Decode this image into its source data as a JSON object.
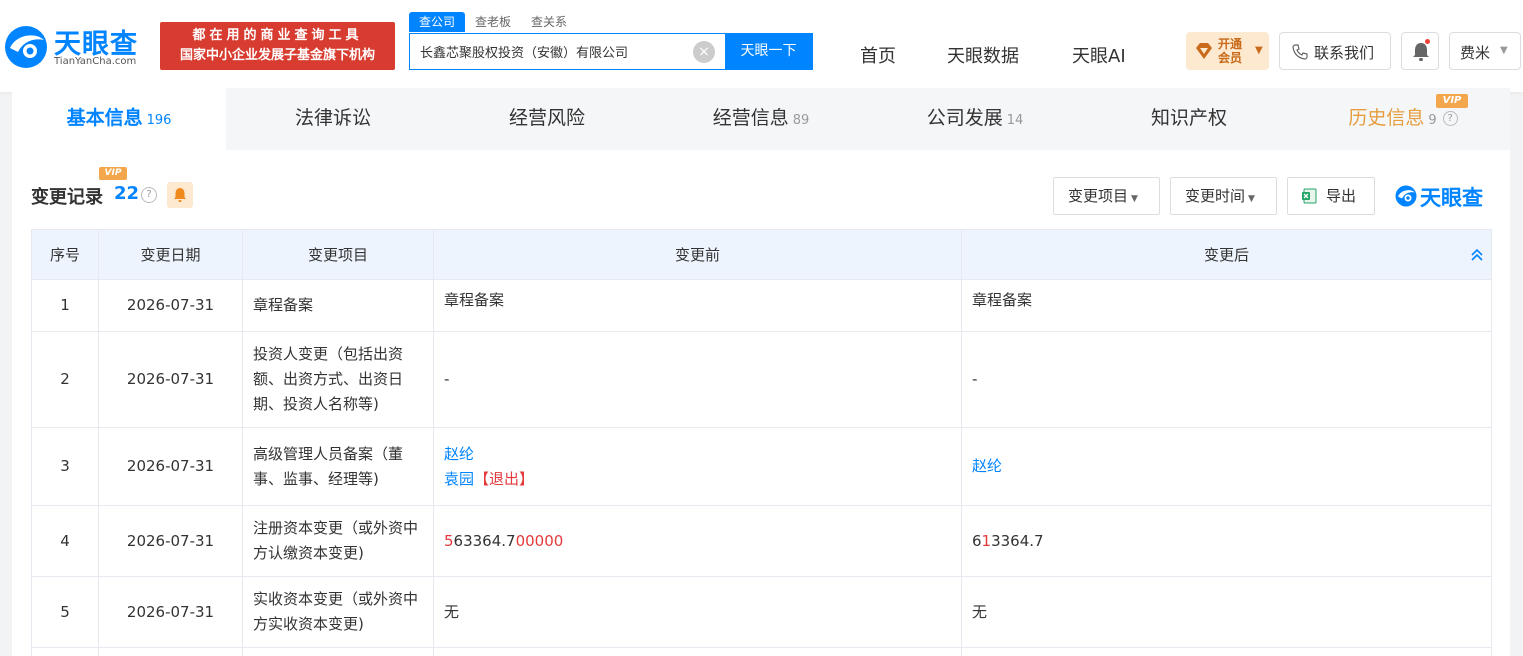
{
  "header": {
    "logo_text": "天眼查",
    "logo_domain": "TianYanCha.com",
    "slogan_line1": "都在用的商业查询工具",
    "slogan_line2": "国家中小企业发展子基金旗下机构",
    "search_tabs": [
      "查公司",
      "查老板",
      "查关系"
    ],
    "search_value": "长鑫芯聚股权投资（安徽）有限公司",
    "search_button": "天眼一下",
    "nav": [
      "首页",
      "天眼数据",
      "天眼AI"
    ],
    "vip_text": "开通会员",
    "contact": "联系我们",
    "user": "费米"
  },
  "tabs": {
    "basic": {
      "label": "基本信息",
      "count": "196"
    },
    "legal": {
      "label": "法律诉讼"
    },
    "risk": {
      "label": "经营风险"
    },
    "operation": {
      "label": "经营信息",
      "count": "89"
    },
    "development": {
      "label": "公司发展",
      "count": "14"
    },
    "ip": {
      "label": "知识产权"
    },
    "history": {
      "label": "历史信息",
      "count": "9",
      "vip": "VIP"
    }
  },
  "section": {
    "title": "变更记录",
    "count": "22",
    "vip": "VIP",
    "filter_item": "变更项目",
    "filter_time": "变更时间",
    "export": "导出",
    "brand": "天眼查"
  },
  "table": {
    "headers": [
      "序号",
      "变更日期",
      "变更项目",
      "变更前",
      "变更后"
    ],
    "rows": [
      {
        "no": "1",
        "date": "2026-07-31",
        "item": "章程备案",
        "before": "章程备案",
        "after": "章程备案"
      },
      {
        "no": "2",
        "date": "2026-07-31",
        "item": "投资人变更（包括出资额、出资方式、出资日期、投资人名称等)",
        "before": "-",
        "after": "-"
      },
      {
        "no": "3",
        "date": "2026-07-31",
        "item": "高级管理人员备案（董事、监事、经理等)",
        "before_person1": "赵纶",
        "before_person2": "袁园",
        "before_exit": "【退出】",
        "after": "赵纶"
      },
      {
        "no": "4",
        "date": "2026-07-31",
        "item": "注册资本变更（或外资中方认缴资本变更)",
        "before_a": "5",
        "before_b": "63364.7",
        "before_c": "00000",
        "after_a": "6",
        "after_b": "1",
        "after_c": "3364.7"
      },
      {
        "no": "5",
        "date": "2026-07-31",
        "item": "实收资本变更（或外资中方实收资本变更)",
        "before": "无",
        "after": "无"
      }
    ]
  },
  "colors": {
    "accent": "#0084ff",
    "red": "#e4393c",
    "vip": "#f3a64b",
    "slogan_bg": "#d83b2f"
  }
}
